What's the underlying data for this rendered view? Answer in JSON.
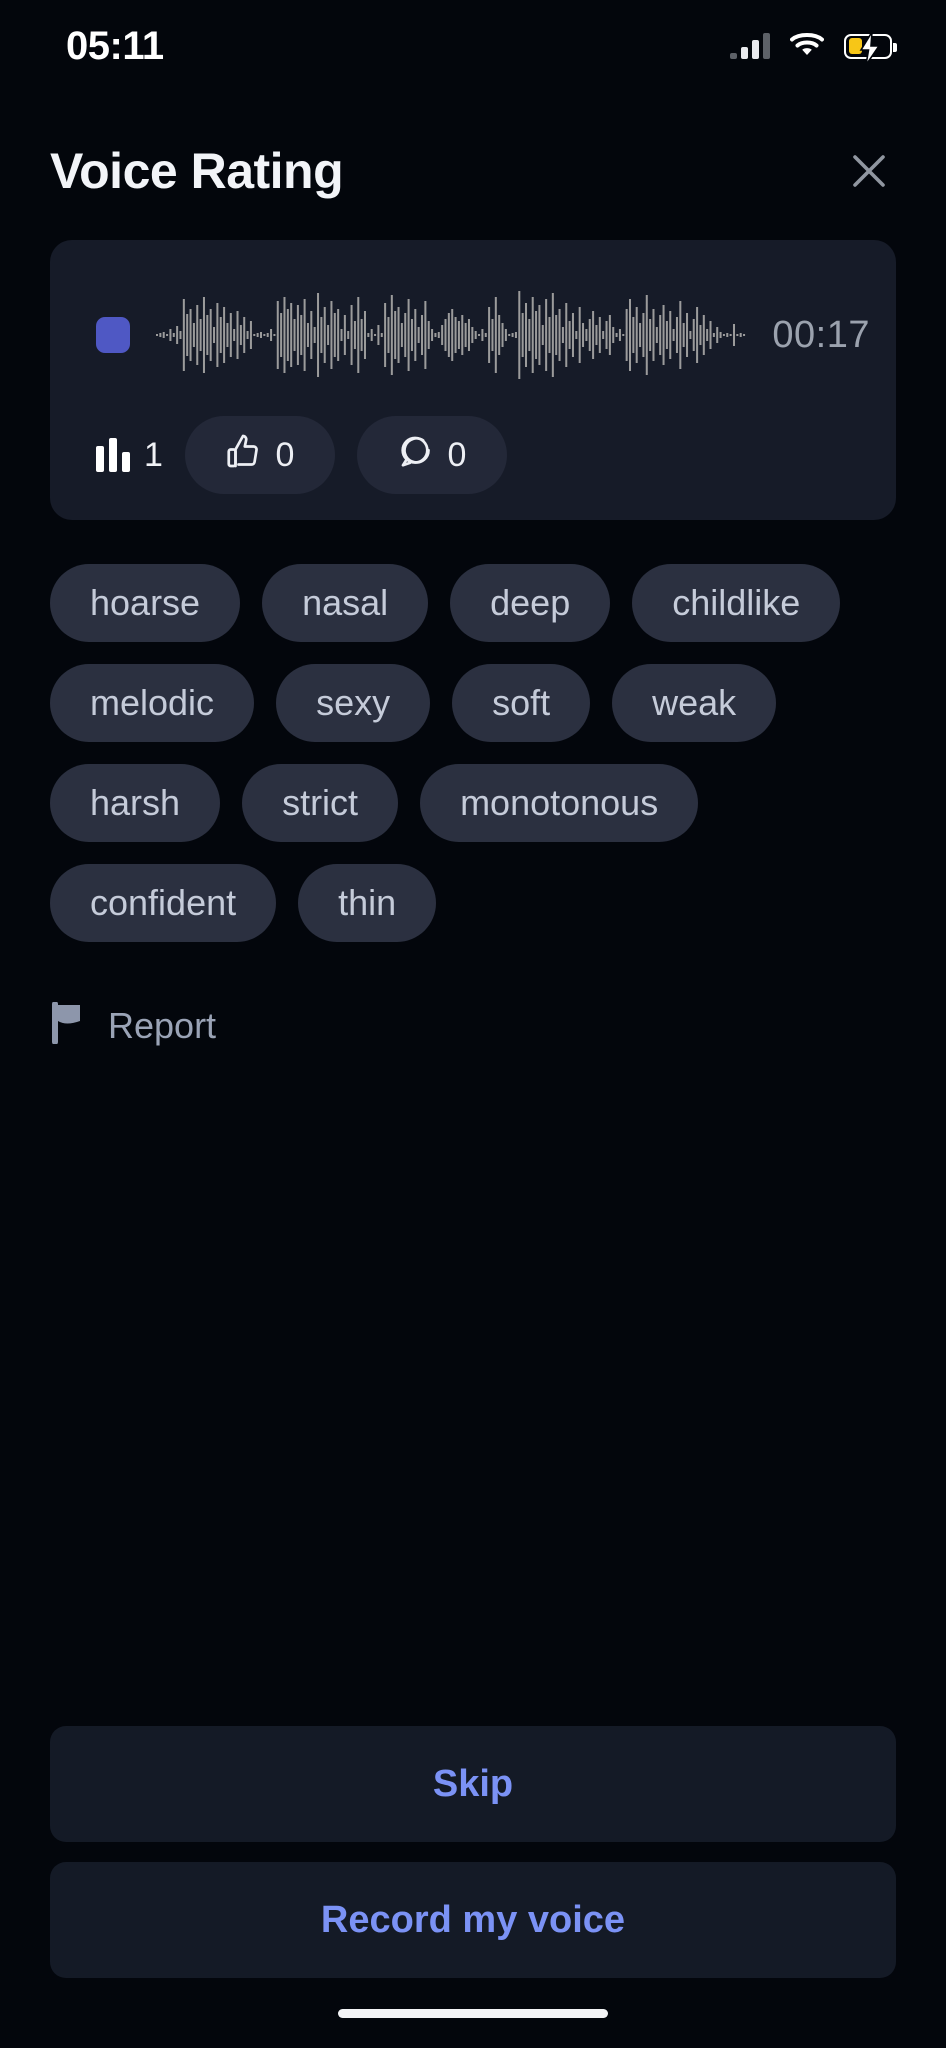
{
  "status_bar": {
    "time": "05:11",
    "signal_icon": "cellular-signal-icon",
    "wifi_icon": "wifi-icon",
    "battery_icon": "battery-charging-icon",
    "battery_level_percent": 34
  },
  "header": {
    "title": "Voice Rating",
    "close_icon": "close-icon"
  },
  "audio_card": {
    "stop_icon": "stop-button-icon",
    "waveform_icon": "audio-waveform",
    "duration": "00:17",
    "stats": {
      "plays_icon": "equalizer-icon",
      "plays": "1",
      "like_icon": "thumbs-up-icon",
      "likes": "0",
      "comment_icon": "comment-bubble-icon",
      "comments": "0"
    }
  },
  "tags": [
    "hoarse",
    "nasal",
    "deep",
    "childlike",
    "melodic",
    "sexy",
    "soft",
    "weak",
    "harsh",
    "strict",
    "monotonous",
    "confident",
    "thin"
  ],
  "report": {
    "icon": "flag-icon",
    "label": "Report"
  },
  "actions": {
    "skip_label": "Skip",
    "record_label": "Record my voice"
  },
  "colors": {
    "background": "#03060c",
    "card": "#161b28",
    "chip": "#2b3040",
    "accent_blue": "#7b92f5",
    "stop_button": "#4f58c4",
    "waveform": "#9b9b9b",
    "muted_text": "#9aa3b6",
    "battery_charging": "#f7c617"
  }
}
